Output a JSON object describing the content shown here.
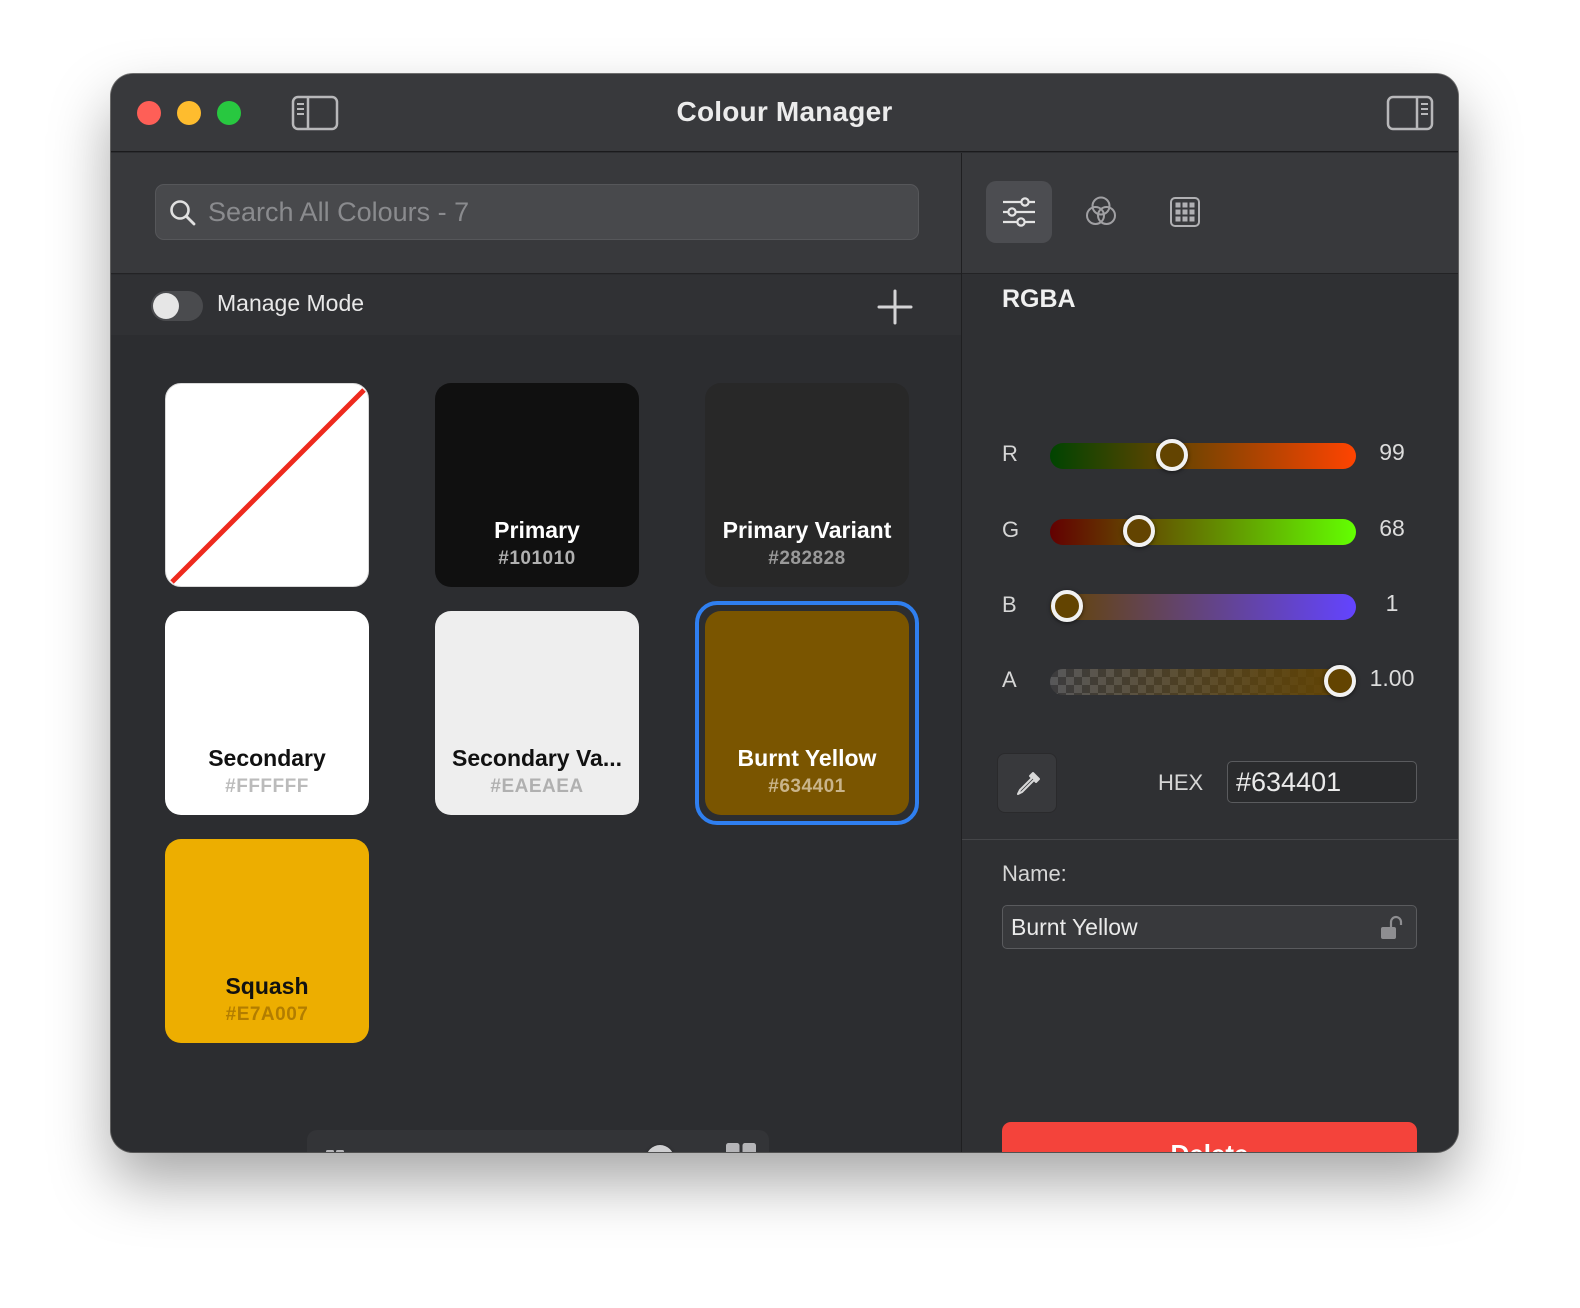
{
  "window": {
    "title": "Colour Manager"
  },
  "search": {
    "placeholder": "Search All Colours - 7"
  },
  "toolbar": {
    "manage_mode_label": "Manage Mode",
    "manage_mode_on": false
  },
  "swatches": [
    {
      "name": "",
      "hex": "",
      "color": "#FFFFFF",
      "type": "none"
    },
    {
      "name": "Primary",
      "hex": "#101010",
      "color": "#101010",
      "text_color": "#FFFFFF",
      "hex_color": "#B0B0B0"
    },
    {
      "name": "Primary Variant",
      "hex": "#282828",
      "color": "#282828",
      "text_color": "#FFFFFF",
      "hex_color": "#9A9A9A"
    },
    {
      "name": "Secondary",
      "hex": "#FFFFFF",
      "color": "#FFFFFF",
      "text_color": "#111111",
      "hex_color": "#BBBBBB"
    },
    {
      "name": "Secondary Va...",
      "hex": "#EAEAEA",
      "color": "#EEEEEE",
      "text_color": "#111111",
      "hex_color": "#B0B0B0"
    },
    {
      "name": "Burnt Yellow",
      "hex": "#634401",
      "color": "#7A5500",
      "text_color": "#FFFFFF",
      "hex_color": "#C9B48A",
      "selected": true
    },
    {
      "name": "Squash",
      "hex": "#E7A007",
      "color": "#EDAE00",
      "text_color": "#111111",
      "hex_color": "#B27D00"
    }
  ],
  "grid_size": {
    "value": 0.9
  },
  "inspector": {
    "tabs": [
      {
        "name": "sliders",
        "active": true
      },
      {
        "name": "colour-circles",
        "active": false
      },
      {
        "name": "palette-grid",
        "active": false
      }
    ],
    "mode_title": "RGBA",
    "sliders": [
      {
        "label": "R",
        "value": "99",
        "fraction": 0.388,
        "gradient": "linear-gradient(90deg, #004401, #ff4401)"
      },
      {
        "label": "G",
        "value": "68",
        "fraction": 0.267,
        "gradient": "linear-gradient(90deg, #630001, #63ff01)"
      },
      {
        "label": "B",
        "value": "1",
        "fraction": 0.004,
        "gradient": "linear-gradient(90deg, #634400, #6344ff)"
      },
      {
        "label": "A",
        "value": "1.00",
        "fraction": 1.0,
        "gradient": "linear-gradient(90deg, rgba(99,68,1,0), rgba(99,68,1,1))"
      }
    ],
    "current_color": "#634401",
    "hex_label": "HEX",
    "hex_value": "#634401",
    "name_label": "Name:",
    "name_value": "Burnt Yellow",
    "delete_label": "Delete"
  },
  "colors": {
    "selection": "#2F7FF0",
    "delete": "#F4433B",
    "diagonal": "#EE2A1E"
  }
}
